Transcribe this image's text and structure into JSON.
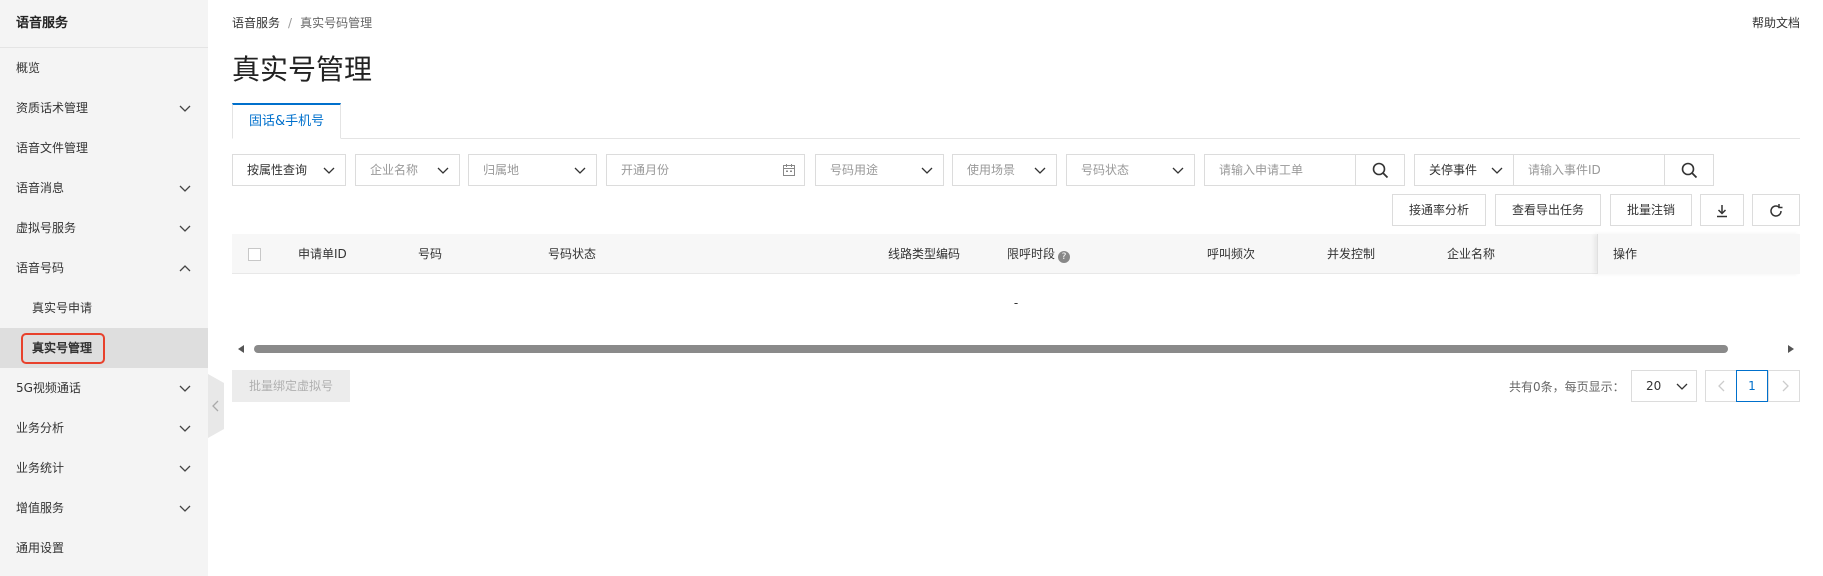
{
  "sidebar": {
    "title": "语音服务",
    "items": [
      {
        "label": "概览"
      },
      {
        "label": "资质话术管理"
      },
      {
        "label": "语音文件管理"
      },
      {
        "label": "语音消息"
      },
      {
        "label": "虚拟号服务"
      },
      {
        "label": "语音号码"
      },
      {
        "label": "真实号申请"
      },
      {
        "label": "真实号管理"
      },
      {
        "label": "5G视频通话"
      },
      {
        "label": "业务分析"
      },
      {
        "label": "业务统计"
      },
      {
        "label": "增值服务"
      },
      {
        "label": "通用设置"
      }
    ]
  },
  "breadcrumb": {
    "root": "语音服务",
    "sep": "/",
    "current": "真实号码管理"
  },
  "help_link": "帮助文档",
  "page_title": "真实号管理",
  "tabs": [
    {
      "label": "固话&手机号"
    }
  ],
  "filters": {
    "query_type": "按属性查询",
    "company": "企业名称",
    "location": "归属地",
    "open_month": "开通月份",
    "usage": "号码用途",
    "scene": "使用场景",
    "status": "号码状态",
    "ticket_placeholder": "请输入申请工单",
    "event_type": "关停事件",
    "event_placeholder": "请输入事件ID"
  },
  "actions": {
    "connect_rate": "接通率分析",
    "export_tasks": "查看导出任务",
    "batch_cancel": "批量注销"
  },
  "table": {
    "columns": [
      "申请单ID",
      "号码",
      "号码状态",
      "线路类型编码",
      "限呼时段",
      "呼叫频次",
      "并发控制",
      "企业名称",
      "操作"
    ],
    "empty_text": "-"
  },
  "footer": {
    "batch_bind": "批量绑定虚拟号",
    "total_text": "共有0条，每页显示：",
    "page_size": "20",
    "current_page": "1"
  },
  "colors": {
    "accent": "#0070cc",
    "highlight": "#e8412c"
  }
}
